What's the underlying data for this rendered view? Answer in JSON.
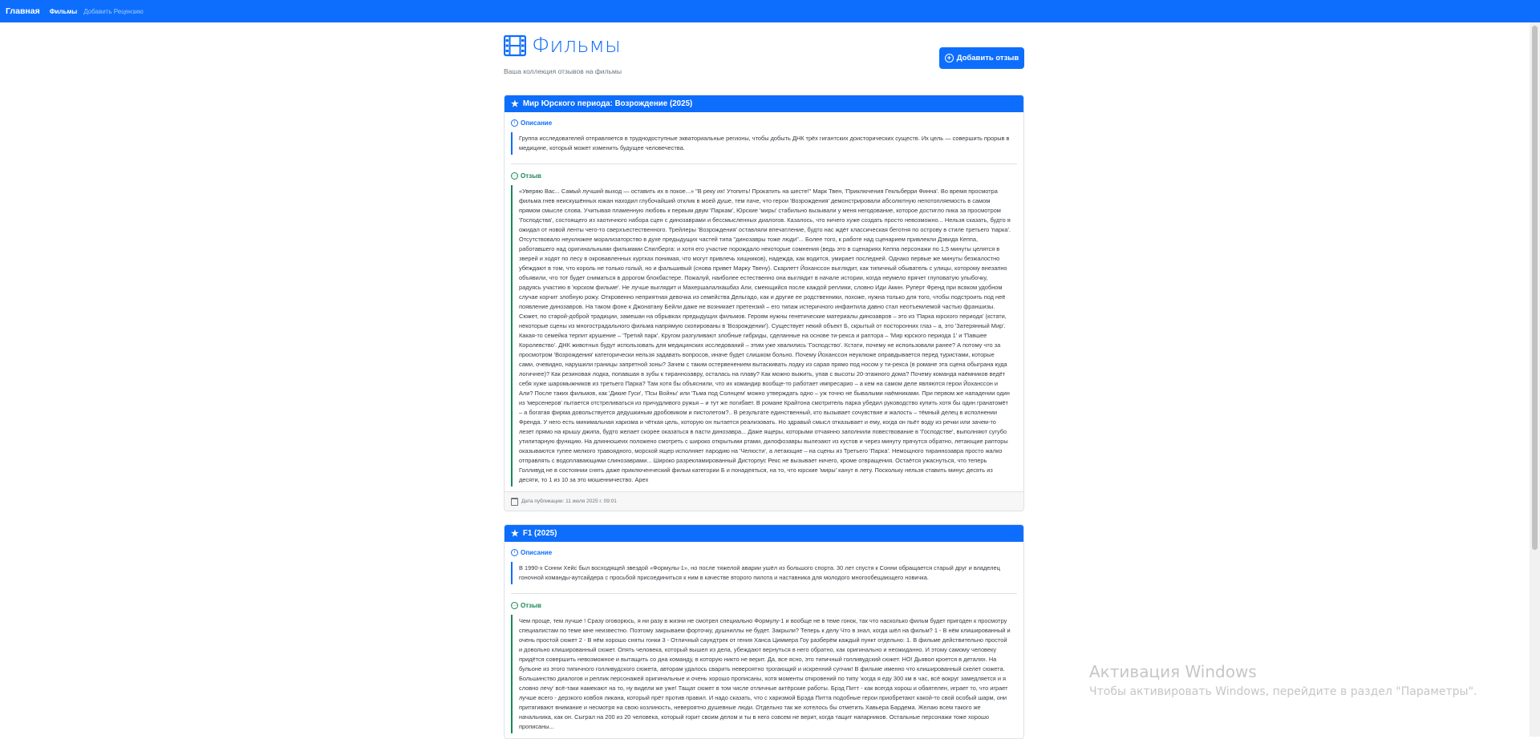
{
  "nav": {
    "brand": "Главная",
    "links": [
      "Фильмы",
      "Добавить Рецензию"
    ]
  },
  "header": {
    "title": "Фильмы",
    "subtitle": "Ваша коллекция отзывов на фильмы",
    "add_button": "Добавить отзыв"
  },
  "labels": {
    "description": "Описание",
    "review": "Отзыв"
  },
  "reviews": [
    {
      "title": "Мир Юрского периода: Возрождение (2025)",
      "description": "Группа исследователей отправляется в труднодоступные экваториальные регионы, чтобы добыть ДНК трёх гигантских доисторических существ. Их цель — совершить прорыв в медицине, который может изменить будущее человечества.",
      "review": "«Уверяю Вас... Самый лучший выход — оставить их в покое...» \"В реку их! Утопить! Прокатить на шесте!\" Марк Твен, 'Приключения Гекльберри Финна'. Во время просмотра фильма гнев неискушённых южан находил глубочайший отклик в моей душе, тем паче, что герои 'Возрождения' демонстрировали абсолютную непотопляемость в самом прямом смысле слова. Учитывая пламенную любовь к первым двум 'Паркам', Юрские 'миры' стабильно вызывали у меня негодование, которое достигло пика за просмотром 'Господства', состоящего из хаотичного набора сцен с динозаврами и бессмысленных диалогов. Казалось, что ничего хуже создать просто невозможно... Нельзя сказать, будто я ожидал от новой ленты чего-то сверхъестественного. Трейлеры 'Возрождения' оставляли впечатление, будто нас ждёт классическая беготня по острову в стиле третьего 'парка'. Отсутствовало неуклюжее морализаторство в духе предыдущих частей типа \"динозавры тоже люди\"... Более того, к работе над сценарием привлекли Дэвида Кеппа, работавшего над оригинальными фильмами Спилберга: и хотя его участие порождало некоторые сомнения (ведь это в сценариях Кеппа персонажи по 1,5 минуты целятся в зверей и ходят по лесу в окровавленных куртках понимая, что могут привлечь хищников), надежда, как водится, умирает последней. Однако первые же минуты безжалостно убеждают в том, что король не только голый, но и фальшивый (снова привет Марку Твену). Скарлетт Йоханссон выглядит, как типичный обыватель с улицы, которому внезапно объявили, что тот будет сниматься в дорогом блокбастере. Пожалуй, наиболее естественно она выглядит в начале истории, когда неумело прячет глуповатую улыбочку, радуясь участию в 'юрском фильме'. Не лучше выглядит и Махершалалхашбаз Али, смеющийся после каждой реплики, словно Иди Амин. Руперт Френд при всяком удобном случае корчит злобную рожу. Откровенно неприятная девочка из семейства Дельгадо, как и другие ее родственники, похоже, нужна только для того, чтобы подстроить под неё появление динозавров. На таком фоне к Джонатану Бейли даже не возникает претензий – его типаж истеричного инфантила давно стал неотъемлемой частью франшизы. Сюжет, по старой-доброй традиции, замешан на обрывках предыдущих фильмов. Героям нужны генетические материалы динозавров – это из 'Парка юрского периода' (кстати, некоторые сцены из многострадального фильма напрямую скопированы в 'Возрождении'). Существует некий объект Б, скрытый от посторонних глаз – а, это 'Затерянный Мир'. Какая-то семейка терпит крушение – 'Третий парк'. Кругом разгуливают злобные гибриды, сделанные на основе ти-рекса и раптора – 'Мир юрского периода 1' и 'Павшее Королевство'. ДНК животных будут использовать для медицинских исследований – этим уже хвалились 'Господство'. Кстати, почему не использовали ранее? А потому что за просмотром 'Возрождения' категорически нельзя задавать вопросов, иначе будет слишком больно. Почему Йоханссон неуклюже оправдывается перед туристами, которые сами, очевидно, нарушили границы запретной зоны? Зачем с таким остервенением вытаскивать лодку из сарая прямо под носом у ти-рекса (в романе эта сцена обыграна куда логичнее)? Как резиновая лодка, попавшая в зубы к тираннозавру, осталась на плаву? Как можно выжить, упав с высоты 20-этажного дома? Почему команда наёмников ведёт себя хуже шаромыжников из третьего Парка? Там хотя бы объяснили, что их командир вообще-то работает импресарио – а кем на самом деле являются герои Йоханссон и Али? После таких фильмов, как 'Дикие Гуси', 'Псы Войны' или 'Тьма под Солнцем' можно утверждать одно – уж точно не бывалыми наёмниками. При первом же нападении один из 'мерсенеров' пытается отстреливаться из причудливого ружья – и тут же погибает. В романе Крайтона смотритель парка убедил руководство купить хотя бы один гранатомёт – а богатая фирма довольствуется дедушкиным дробовиком и пистолетом?.. В результате единственный, кто вызывает сочувствие и жалость – тёмный делец в исполнении Френда. У него есть минимальная харизма и чёткая цель, которую он пытается реализовать. Но здравый смысл отказывает и ему, когда он пьёт воду из речки или зачем-то лезет прямо на крышу джипа, будто желает скорее оказаться в пасти динозавра... Даже ящеры, которыми отчаянно заполнили повествование в 'Господстве', выполняют сугубо утилитарную функцию. На длинношеих положено смотреть с широко открытыми ртами, дилофозавры вылезают из кустов и через минуту прячутся обратно, летающие рапторы оказываются тупее мелкого травоядного, морской ящер исполняет пародию на 'Челюсти', а летающие – на сцены из Третьего 'Парка'. Немощного тираннозавра просто жалко отправлять с водоплавающими слинозаврами... Широко разрекламированный Дисторпус Рекс не вызывает ничего, кроме отвращения. Остаётся ужаснуться, что теперь Голливуд не в состоянии снять даже приключенческий фильм категории Б и понадеяться, на то, что юрские 'миры' канут в лету. Поскольку нельзя ставить минус десять из десяти, то 1 из 10 за это мошенничество. Apex",
      "date": "Дата публикации: 11 июля 2025 г. 09:01"
    },
    {
      "title": "F1 (2025)",
      "description": "В 1990-х Сонни Хейс был восходящей звездой «Формулы-1», но после тяжелой аварии ушёл из большого спорта. 30 лет спустя к Сонни обращается старый друг и владелец гоночной команды-аутсайдера с просьбой присоединиться к ним в качестве второго пилота и наставника для молодого многообещающего новичка.",
      "review": "Чем проще, тем лучше ! Сразу оговорюсь, я ни разу в жизни не смотрел специально Формулу-1 и вообще не в теме гонок, так что насколько фильм будет пригоден к просмотру специалистам по теме мне неизвестно. Поэтому закрываем форточку, душниллы не будет. Закрыли? Теперь к делу Что в знал, когда шёл на фильм? 1 - В нём клишированный и очень простой сюжет 2 - В нём хорошо сняты гонки 3 - Отличный саундтрек от гения Ханса Циммера Гоу разберём каждый пункт отдельно: 1. В фильме действительно простой и довольно клишированный сюжет. Опять человека, который вышел из дела, убеждают вернуться в него обратно, как оригинально и неожиданно. И этому самому человеку придётся совершить невозможное и вытащить со дна команду, в которую никто не верит. Да, все ясно, это типичный голливудский сюжет. НО! Дьявол кроется в деталях. На бульоне из этого типичного голливудского сюжета, авторам удалось сварить невероятно трогающий и искренний супчик! В фильме именно что клишированный скелет сюжета. Большинство диалогов и реплик персонажей оригинальные и очень хорошо прописаны, хотя моменты откровений по типу 'когда я еду 300 км в час, всё вокруг замедляется и я словно лечу' всё-таки намекают на то, ну видели же уже! Тащат сюжет в том числе отличные актёрские работы. Брэд Питт - как всегда хорош и обаятелен, играет то, что играет лучше всего - дерзкого ковбоя ликана, который прёт против правил. И надо сказать, что с харизмой Брэда Питта подобные герои приобретают какой-то свой особый шарм, они притягивают внимание и несмотря на свою козлиность, невероятно душевные люди. Отдельно так же хотелось бы отметить Хавьера Бардема. Желаю всем такого же начальника, как он. Сыграл на 200 из 20 человека, который горит своим делом и ты в него совсем не верит, когда тащит напарников. Остальные персонажи тоже хорошо прописаны..."
    }
  ],
  "watermark": {
    "title": "Активация Windows",
    "subtitle": "Чтобы активировать Windows, перейдите в раздел \"Параметры\"."
  }
}
